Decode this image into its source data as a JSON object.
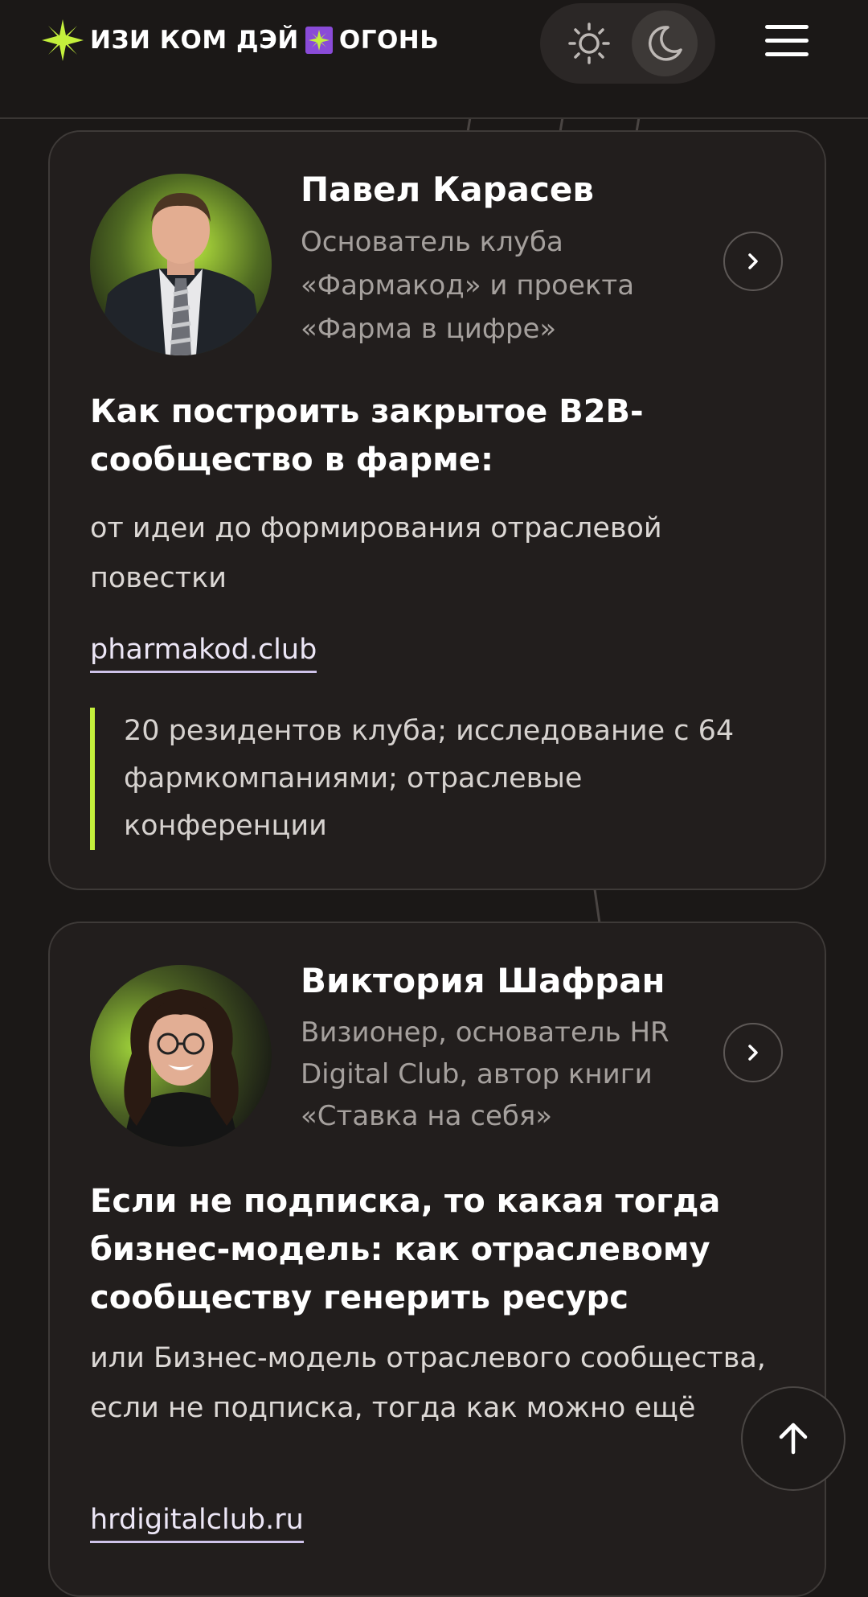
{
  "header": {
    "logo_left": "ИЗИ КОМ ДЭЙ",
    "logo_right": "ОГОНЬ",
    "theme": "dark"
  },
  "speakers": [
    {
      "name": "Павел Карасев",
      "role": "Основатель клуба «Фармакод» и проекта «Фарма в цифре»",
      "talk_title": "Как построить закрытое B2B-сообщество в фарме:",
      "talk_subtitle": "от идеи до формирования отраслевой повестки",
      "link": "pharmakod.club",
      "highlight": "20 резидентов клуба; исследование с 64 фармкомпаниями; отраслевые конференции"
    },
    {
      "name": "Виктория Шафран",
      "role": "Визионер, основатель HR Digital Club, автор книги «Ставка на себя»",
      "talk_title": "Если не подписка, то какая тогда бизнес-модель: как отраслевому сообществу генерить ресурс",
      "talk_subtitle": "или Бизнес-модель отраслевого сообщества, если не подписка, тогда как можно ещё",
      "link": "hrdigitalclub.ru"
    }
  ],
  "colors": {
    "background": "#1b1817",
    "card": "#221e1d",
    "accent_lime": "#c4f03c",
    "accent_purple": "#8a4bd8",
    "muted_text": "#a5a09d"
  },
  "icons": [
    "sparkle-logo-icon",
    "sun-icon",
    "moon-icon",
    "hamburger-menu-icon",
    "chevron-right-icon",
    "arrow-up-icon"
  ]
}
